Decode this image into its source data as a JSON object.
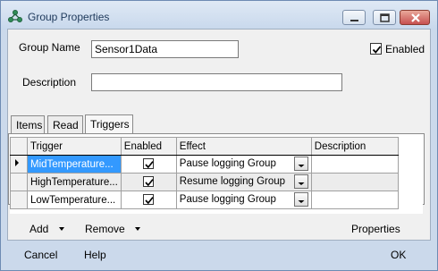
{
  "window": {
    "title": "Group Properties",
    "icon": "app-network-icon"
  },
  "form": {
    "group_name_label": "Group Name",
    "group_name_value": "Sensor1Data",
    "enabled_label": "Enabled",
    "enabled_checked": true,
    "description_label": "Description",
    "description_value": ""
  },
  "tabs": [
    {
      "label": "Items"
    },
    {
      "label": "Read"
    },
    {
      "label": "Triggers",
      "active": true
    }
  ],
  "grid": {
    "columns": [
      "Trigger",
      "Enabled",
      "Effect",
      "Description"
    ],
    "rows": [
      {
        "trigger": "MidTemperature...",
        "enabled": true,
        "effect": "Pause logging Group",
        "description": "",
        "selected": true
      },
      {
        "trigger": "HighTemperature...",
        "enabled": true,
        "effect": "Resume logging Group",
        "description": ""
      },
      {
        "trigger": "LowTemperature...",
        "enabled": true,
        "effect": "Pause logging Group",
        "description": ""
      }
    ]
  },
  "actions": {
    "add": "Add",
    "remove": "Remove",
    "properties": "Properties"
  },
  "footer": {
    "cancel": "Cancel",
    "help": "Help",
    "ok": "OK"
  }
}
